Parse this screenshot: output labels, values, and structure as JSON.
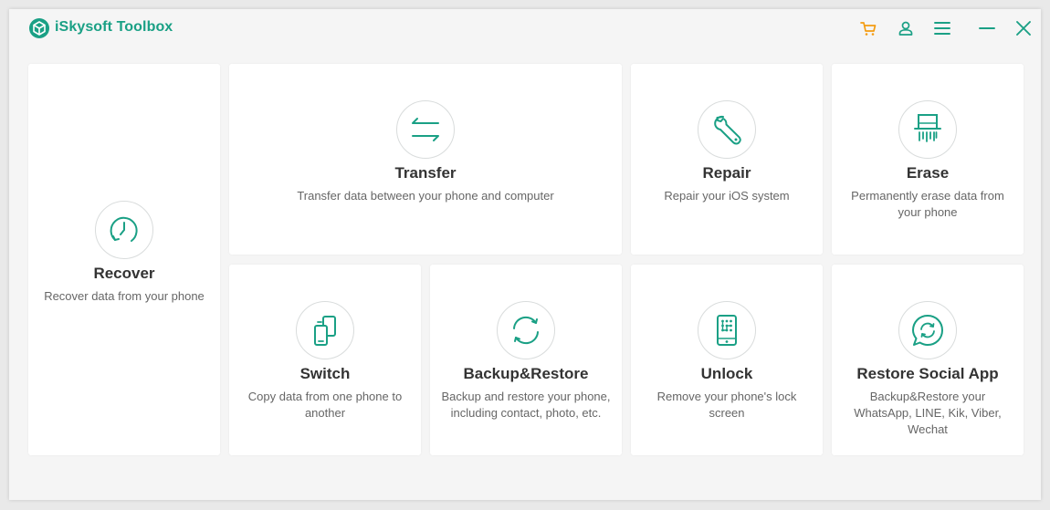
{
  "app": {
    "title": "iSkysoft Toolbox",
    "accent_color": "#1aa085",
    "cart_color": "#f39c12"
  },
  "toolbar": {
    "icons": [
      "cart-icon",
      "user-icon",
      "menu-icon",
      "minimize-icon",
      "close-icon"
    ]
  },
  "cards": {
    "recover": {
      "title": "Recover",
      "desc": "Recover data from your phone",
      "icon": "clock-icon"
    },
    "transfer": {
      "title": "Transfer",
      "desc": "Transfer data between your phone and computer",
      "icon": "transfer-arrows-icon"
    },
    "repair": {
      "title": "Repair",
      "desc": "Repair your iOS system",
      "icon": "wrench-icon"
    },
    "erase": {
      "title": "Erase",
      "desc": "Permanently erase data from your phone",
      "icon": "shredder-icon"
    },
    "switch": {
      "title": "Switch",
      "desc": "Copy data from one phone to another",
      "icon": "phones-switch-icon"
    },
    "backup": {
      "title": "Backup&Restore",
      "desc": "Backup and restore your phone, including contact, photo, etc.",
      "icon": "sync-icon"
    },
    "unlock": {
      "title": "Unlock",
      "desc": "Remove your phone's lock screen",
      "icon": "phone-lock-icon"
    },
    "social": {
      "title": "Restore Social App",
      "desc": "Backup&Restore your WhatsApp, LINE, Kik, Viber, Wechat",
      "icon": "chat-sync-icon"
    }
  }
}
